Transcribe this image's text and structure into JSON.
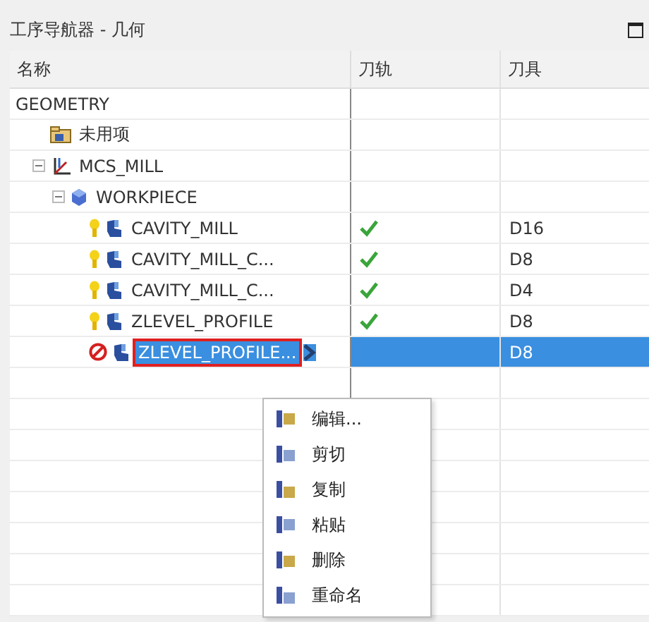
{
  "panel": {
    "title": "工序导航器 - 几何"
  },
  "table": {
    "columns": [
      "名称",
      "刀轨",
      "刀具"
    ],
    "rows": [
      {
        "name": "GEOMETRY",
        "selected": false,
        "children": [
          {
            "name": "未用项",
            "kind": "folder",
            "selected": false
          },
          {
            "name": "MCS_MILL",
            "kind": "mcs",
            "selected": false,
            "expanded": true,
            "children": [
              {
                "name": "WORKPIECE",
                "kind": "workpiece",
                "selected": false,
                "expanded": true,
                "children": [
                  {
                    "name": "CAVITY_MILL",
                    "kind": "operation",
                    "blocked": false,
                    "toolpath_done": true,
                    "tool": "D16",
                    "selected": false
                  },
                  {
                    "name": "CAVITY_MILL_C...",
                    "kind": "operation",
                    "blocked": false,
                    "toolpath_done": true,
                    "tool": "D8",
                    "selected": false
                  },
                  {
                    "name": "CAVITY_MILL_C...",
                    "kind": "operation",
                    "blocked": false,
                    "toolpath_done": true,
                    "tool": "D4",
                    "selected": false
                  },
                  {
                    "name": "ZLEVEL_PROFILE",
                    "kind": "operation",
                    "blocked": false,
                    "toolpath_done": true,
                    "tool": "D8",
                    "selected": false
                  },
                  {
                    "name": "ZLEVEL_PROFILE...",
                    "kind": "operation",
                    "blocked": true,
                    "toolpath_done": false,
                    "tool": "D8",
                    "selected": true
                  }
                ]
              }
            ]
          }
        ]
      }
    ]
  },
  "context_menu": {
    "items": [
      "编辑...",
      "剪切",
      "复制",
      "粘贴",
      "删除",
      "重命名"
    ]
  }
}
